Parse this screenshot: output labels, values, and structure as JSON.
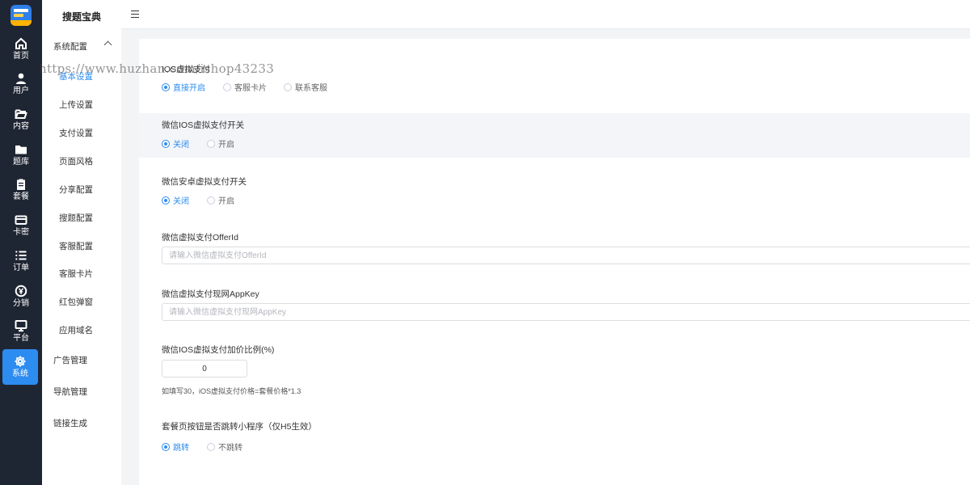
{
  "rail": {
    "items": [
      {
        "label": "首页",
        "icon": "home-icon"
      },
      {
        "label": "用户",
        "icon": "user-icon"
      },
      {
        "label": "内容",
        "icon": "folder-open-icon"
      },
      {
        "label": "题库",
        "icon": "folder-icon"
      },
      {
        "label": "套餐",
        "icon": "clipboard-icon"
      },
      {
        "label": "卡密",
        "icon": "card-icon"
      },
      {
        "label": "订单",
        "icon": "list-icon"
      },
      {
        "label": "分销",
        "icon": "yen-icon"
      },
      {
        "label": "平台",
        "icon": "monitor-icon"
      },
      {
        "label": "系统",
        "icon": "gear-icon"
      }
    ],
    "active_color": "#2d8cf0"
  },
  "sidebar": {
    "title": "搜题宝典",
    "group_system": "系统配置",
    "sub_items": [
      "基本设置",
      "上传设置",
      "支付设置",
      "页面风格",
      "分享配置",
      "搜题配置",
      "客服配置",
      "客服卡片",
      "红包弹窗",
      "应用域名"
    ],
    "group_ads": "广告管理",
    "group_nav": "导航管理",
    "group_link": "链接生成"
  },
  "form": {
    "ios_pay": {
      "label": "IOS虚拟支付",
      "options": [
        "直接开启",
        "客服卡片",
        "联系客服"
      ]
    },
    "wx_ios_switch": {
      "label": "微信IOS虚拟支付开关",
      "options": [
        "关闭",
        "开启"
      ]
    },
    "wx_android_switch": {
      "label": "微信安卓虚拟支付开关",
      "options": [
        "关闭",
        "开启"
      ]
    },
    "offer_id": {
      "label": "微信虚拟支付OfferId",
      "placeholder": "请输入微信虚拟支付OfferId",
      "value": ""
    },
    "app_key": {
      "label": "微信虚拟支付现网AppKey",
      "placeholder": "请输入微信虚拟支付现网AppKey",
      "value": ""
    },
    "markup": {
      "label": "微信IOS虚拟支付加价比例(%)",
      "value": "0",
      "hint": "如填写30，iOS虚拟支付价格=套餐价格*1.3"
    },
    "jump_mini": {
      "label": "套餐页按钮是否跳转小程序（仅H5生效）",
      "options": [
        "跳转",
        "不跳转"
      ]
    }
  },
  "watermark": "https://www.huzhan.com/ishop43233"
}
